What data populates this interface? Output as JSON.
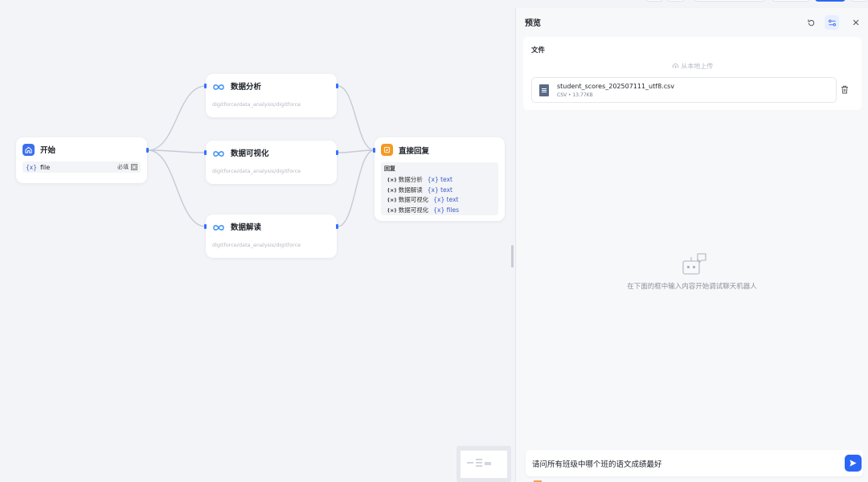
{
  "nodes": {
    "start": {
      "title": "开始",
      "var_x": "{x}",
      "var_name": "file",
      "required_label": "必填"
    },
    "analysis": {
      "title": "数据分析",
      "path": "digitforce/data_analysis/digitforce"
    },
    "visualize": {
      "title": "数据可视化",
      "path": "digitforce/data_analysis/digitforce"
    },
    "interpret": {
      "title": "数据解读",
      "path": "digitforce/data_analysis/digitforce"
    },
    "reply": {
      "title": "直接回复",
      "section_label": "回复",
      "rows": [
        {
          "src": "数据分析",
          "tgt": "text"
        },
        {
          "src": "数据解读",
          "tgt": "text"
        },
        {
          "src": "数据可视化",
          "tgt": "text"
        },
        {
          "src": "数据可视化",
          "tgt": "files"
        }
      ]
    }
  },
  "panel": {
    "title": "预览",
    "files_label": "文件",
    "upload_label": "从本地上传",
    "file": {
      "name": "student_scores_202507111_utf8.csv",
      "type": "CSV",
      "size": "13.77KB"
    },
    "empty_text": "在下面的框中输入内容开始调试聊天机器人",
    "chat_input": "请问所有班级中哪个班的语文成绩最好"
  },
  "colors": {
    "accent": "#2b66f6",
    "start_icon": "#3b6ff0",
    "reply_icon": "#f59a23",
    "edge": "#c5cad6"
  }
}
